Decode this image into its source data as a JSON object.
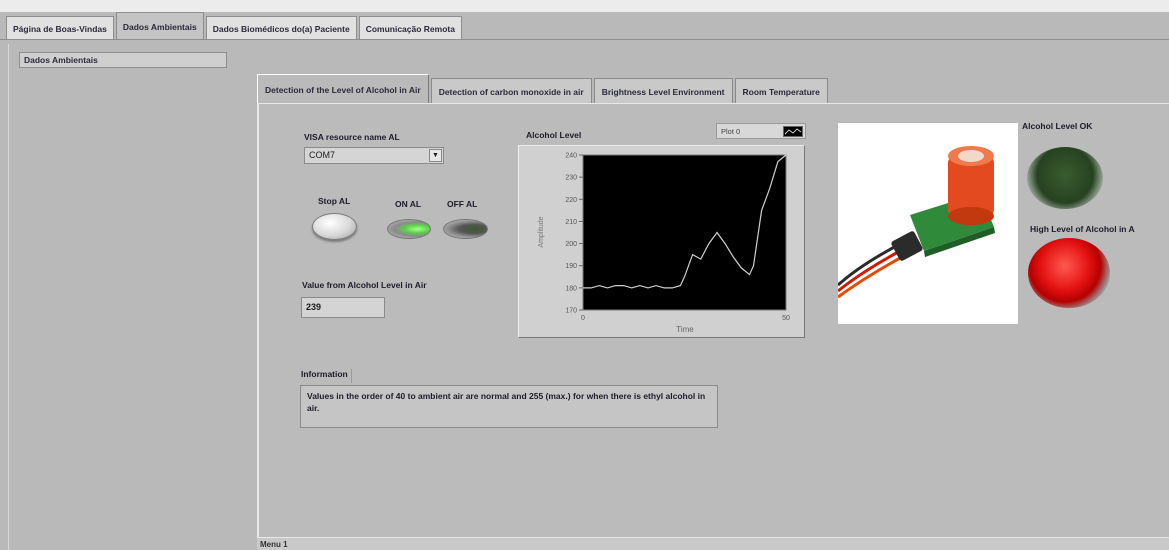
{
  "top_tabs": [
    {
      "label": "Página de Boas-Vindas",
      "active": false
    },
    {
      "label": "Dados Ambientais",
      "active": true
    },
    {
      "label": "Dados Biomédicos do(a) Paciente",
      "active": false
    },
    {
      "label": "Comunicação Remota",
      "active": false
    }
  ],
  "left_panel": {
    "label": "Dados Ambientais"
  },
  "inner_tabs": [
    {
      "label": "Detection of the Level of Alcohol in Air",
      "active": true
    },
    {
      "label": "Detection of carbon monoxide in air",
      "active": false
    },
    {
      "label": "Brightness Level Environment",
      "active": false
    },
    {
      "label": "Room Temperature",
      "active": false
    }
  ],
  "visa": {
    "label": "VISA resource name AL",
    "value": "COM7"
  },
  "buttons": {
    "stop_label": "Stop AL",
    "on_label": "ON AL",
    "off_label": "OFF AL"
  },
  "value_field": {
    "label": "Value from Alcohol Level in Air",
    "value": "239"
  },
  "information": {
    "label": "Information",
    "text": "Values in the order of 40 to ambient air are normal and 255 (max.) for when there is ethyl alcohol in air."
  },
  "indicators": {
    "ok_label": "Alcohol Level OK",
    "high_label": "High Level of Alcohol in A"
  },
  "bottom_bar": {
    "text": "Menu 1"
  },
  "icons": {
    "visa_dropdown": "chevron-down-icon",
    "legend_plot": "plot-line-icon",
    "sensor": "alcohol-sensor-photo"
  },
  "colors": {
    "led_green_off": "#264220",
    "led_red_on": "#e21111",
    "plot_background": "#000000",
    "plot_trace": "#d0d0d0"
  },
  "chart_data": {
    "type": "line",
    "title": "Alcohol Level",
    "legend": [
      "Plot 0"
    ],
    "xlabel": "Time",
    "ylabel": "Amplitude",
    "xlim": [
      0,
      50
    ],
    "ylim": [
      170,
      240
    ],
    "x_ticks": [
      "0",
      "50"
    ],
    "y_ticks": [
      "240",
      "230",
      "220",
      "210",
      "200",
      "190",
      "180",
      "170"
    ],
    "grid": false,
    "series": [
      {
        "name": "Plot 0",
        "x": [
          0,
          2,
          4,
          6,
          8,
          10,
          12,
          14,
          16,
          18,
          20,
          22,
          24,
          25,
          27,
          29,
          31,
          33,
          35,
          37,
          39,
          41,
          42,
          44,
          46,
          48,
          50
        ],
        "y": [
          180,
          180,
          181,
          180,
          181,
          181,
          180,
          181,
          180,
          181,
          180,
          180,
          181,
          185,
          195,
          193,
          200,
          205,
          200,
          194,
          189,
          186,
          190,
          215,
          225,
          237,
          240
        ]
      }
    ]
  }
}
